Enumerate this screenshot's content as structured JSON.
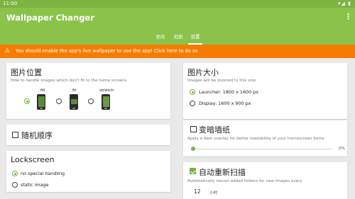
{
  "status": {
    "time": "11:00",
    "icons": "▾◢ ▮"
  },
  "app": {
    "title": "Wallpaper Changer",
    "menu_icon": "⋮"
  },
  "tabs": [
    {
      "label": "更改"
    },
    {
      "label": "相册"
    },
    {
      "label": "设置",
      "active": true
    }
  ],
  "warning": {
    "icon": "⚠",
    "text": "You should enable the app's live wallpaper to use the app! Click here to do so"
  },
  "image_position": {
    "title": "图片位置",
    "subtitle": "How to handle images which don't fit to the home screens",
    "options": [
      {
        "label": "fill",
        "selected": true
      },
      {
        "label": "fit",
        "selected": false
      },
      {
        "label": "strwtch",
        "selected": false
      }
    ]
  },
  "image_size": {
    "title": "图片大小",
    "subtitle": "Images will be zoomed to this size",
    "options": [
      {
        "label": "Launcher: 1800 x 1600 px",
        "selected": true
      },
      {
        "label": "Display: 1600 x 900 px",
        "selected": false
      }
    ]
  },
  "random_order": {
    "label": "随机顺序",
    "checked": false
  },
  "darken": {
    "label": "变暗墙纸",
    "checked": false,
    "subtitle": "Apply a dark overlay for better readability of your homescreen items",
    "value": "0%",
    "level": 0
  },
  "lockscreen": {
    "title": "Lockscreen",
    "options": [
      {
        "label": "no special handling",
        "selected": true
      },
      {
        "label": "static image",
        "selected": false
      }
    ]
  },
  "auto_rescan": {
    "label": "自动重新扫描",
    "checked": true,
    "subtitle": "Automatically rescan added folders for new images every",
    "interval": "12",
    "unit": "小时"
  },
  "colors": {
    "primary": "#8bc34a",
    "status": "#7cb342",
    "warning": "#f57c00"
  }
}
